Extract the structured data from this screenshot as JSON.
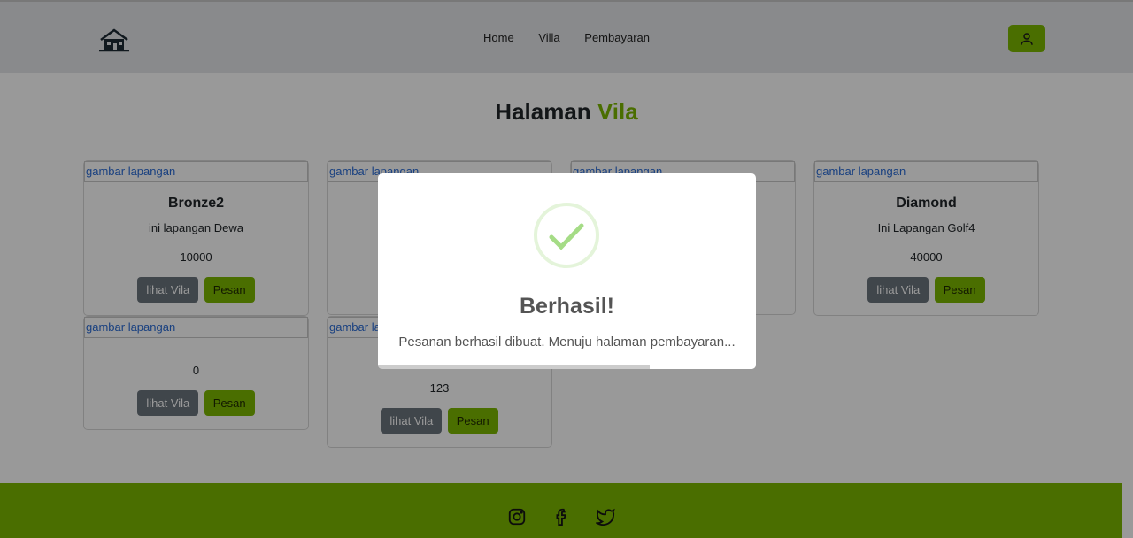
{
  "nav": {
    "logo_icon": "house-icon",
    "links": [
      "Home",
      "Villa",
      "Pembayaran"
    ],
    "user_icon": "user-icon"
  },
  "page": {
    "title_main": "Halaman",
    "title_accent": "Vila"
  },
  "cards": [
    {
      "img_alt": "gambar lapangan",
      "title": "Bronze2",
      "desc": "ini lapangan Dewa",
      "price": "10000",
      "btn_view": "lihat Vila",
      "btn_order": "Pesan"
    },
    {
      "img_alt": "gambar lapangan",
      "title": "",
      "desc": "",
      "price": "",
      "btn_view": "",
      "btn_order": ""
    },
    {
      "img_alt": "gambar lapangan",
      "title": "",
      "desc": "",
      "price": "",
      "btn_view": "",
      "btn_order": ""
    },
    {
      "img_alt": "gambar lapangan",
      "title": "Diamond",
      "desc": "Ini Lapangan Golf4",
      "price": "40000",
      "btn_view": "lihat Vila",
      "btn_order": "Pesan"
    },
    {
      "img_alt": "gambar lapangan",
      "title": "",
      "desc": "",
      "price": "0",
      "btn_view": "lihat Vila",
      "btn_order": "Pesan"
    },
    {
      "img_alt": "gambar lapangan",
      "title": "",
      "desc": "",
      "price": "123",
      "btn_view": "lihat Vila",
      "btn_order": "Pesan"
    }
  ],
  "footer": {
    "icons": [
      "instagram-icon",
      "facebook-icon",
      "twitter-icon"
    ]
  },
  "modal": {
    "icon": "check-icon",
    "title": "Berhasil!",
    "message": "Pesanan berhasil dibuat. Menuju halaman pembayaran...",
    "progress": 0.72
  },
  "colors": {
    "accent": "#7cb701",
    "button_gray": "#6c757d",
    "success_check": "#a5dc86"
  }
}
